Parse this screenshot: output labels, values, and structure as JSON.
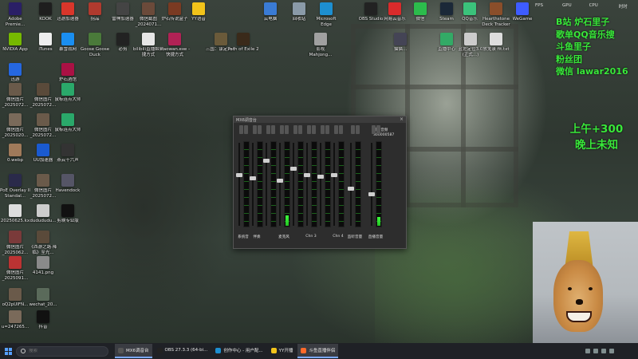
{
  "desktop_icons": [
    {
      "label": "Adobe Premie...",
      "color": "#2a1f66",
      "icon": "premiere-icon"
    },
    {
      "label": "KOOK",
      "color": "#1e1e1e",
      "icon": "kook-icon"
    },
    {
      "label": "迅游加速器",
      "color": "#d9362b",
      "icon": "xunyou-icon"
    },
    {
      "label": "拐品",
      "color": "#b03a2e",
      "icon": "app-icon"
    },
    {
      "label": "雷神加速器",
      "color": "#444",
      "icon": "leishen-icon"
    },
    {
      "label": "微信截图_2024071...",
      "color": "#6b4a3a",
      "icon": "image-icon"
    },
    {
      "label": "炉石传说盒子",
      "color": "#7a3a22",
      "icon": "hearthstone-box-icon"
    },
    {
      "label": "YY语音",
      "color": "#f2c31a",
      "icon": "yy-icon"
    },
    {
      "label": "云电脑",
      "color": "#3a7bd5",
      "icon": "cloud-pc-icon"
    },
    {
      "label": "回收站",
      "color": "#8a9aa8",
      "icon": "recycle-bin-icon"
    },
    {
      "label": "Microsoft Edge",
      "color": "#1d8fd1",
      "icon": "edge-icon"
    },
    {
      "label": "OBS Studio",
      "color": "#222",
      "icon": "obs-icon"
    },
    {
      "label": "网易云音乐",
      "color": "#d92b2b",
      "icon": "netease-icon"
    },
    {
      "label": "微信",
      "color": "#2cbc4c",
      "icon": "wechat-icon"
    },
    {
      "label": "Steam",
      "color": "#1b2838",
      "icon": "steam-icon"
    },
    {
      "label": "QQ音乐",
      "color": "#3bc27b",
      "icon": "qqmusic-icon"
    },
    {
      "label": "Hearthstone Deck Tracker",
      "color": "#8a4e2a",
      "icon": "hdt-icon"
    },
    {
      "label": "WeGame",
      "color": "#3e5cff",
      "icon": "wegame-icon"
    },
    {
      "label": "NVIDIA App",
      "color": "#76b900",
      "icon": "nvidia-icon"
    },
    {
      "label": "iTunes",
      "color": "#eeeeee",
      "icon": "itunes-icon"
    },
    {
      "label": "暴雪战网",
      "color": "#1a8ef0",
      "icon": "battlenet-icon"
    },
    {
      "label": "Goose Goose Duck",
      "color": "#4a7a3a",
      "icon": "goose-icon"
    },
    {
      "label": "必剪",
      "color": "#222",
      "icon": "bijian-icon"
    },
    {
      "label": "bilibili直播姬快捷方式",
      "color": "#e6e6e6",
      "icon": "bilibili-icon"
    },
    {
      "label": "xiaowan.exe - 快捷方式",
      "color": "#b02255",
      "icon": "xiaowan-icon"
    },
    {
      "label": "三国：谋定天下",
      "color": "#6a5a3a",
      "icon": "sanguo-icon"
    },
    {
      "label": "Path of Exile 2",
      "color": "#3a2a1a",
      "icon": "poe2-icon"
    },
    {
      "label": "影视 Mahjong...",
      "color": "#a0a0a0",
      "icon": "mahjong-icon"
    },
    {
      "label": "猫猫...",
      "color": "#445",
      "icon": "app-icon"
    },
    {
      "label": "直播中心",
      "color": "#3a6",
      "icon": "live-center-icon"
    },
    {
      "label": "蓝佐定位3.0 (正式...)",
      "color": "#ccc",
      "icon": "doc-icon"
    },
    {
      "label": "放鬼录 fit.txt",
      "color": "#ddd",
      "icon": "txt-icon"
    },
    {
      "label": "迅游",
      "color": "#2567e0",
      "icon": "xunyou2-icon"
    },
    {
      "label": "炉石酒馆",
      "color": "#a14",
      "icon": "tavern-icon"
    },
    {
      "label": "微信图片_2025072...",
      "color": "#6a5a4a",
      "icon": "image-icon"
    },
    {
      "label": "微信图片_2025072...",
      "color": "#5a4a3a",
      "icon": "image-icon"
    },
    {
      "label": "鼠标连点大师",
      "color": "#2aa86a",
      "icon": "autoclick-icon"
    },
    {
      "label": "微信图片_2025020...",
      "color": "#7a6a5a",
      "icon": "image-icon"
    },
    {
      "label": "微信图片_2025072...",
      "color": "#6a5a4a",
      "icon": "image-icon"
    },
    {
      "label": "鼠标连点大师",
      "color": "#2aa86a",
      "icon": "autoclick-icon"
    },
    {
      "label": "0.webp",
      "color": "#a07a5a",
      "icon": "image-icon"
    },
    {
      "label": "UU加速器",
      "color": "#1a5ad0",
      "icon": "uu-icon"
    },
    {
      "label": "燕云十六声",
      "color": "#333",
      "icon": "yanyun-icon"
    },
    {
      "label": "PoE Overlay II Standal...",
      "color": "#2a2a4a",
      "icon": "poe-overlay-icon"
    },
    {
      "label": "微信图片_2025072...",
      "color": "#6a5a4a",
      "icon": "image-icon"
    },
    {
      "label": "Havendock",
      "color": "#556",
      "icon": "havendock-icon"
    },
    {
      "label": "20250625.kx",
      "color": "#ddd",
      "icon": "doc-icon"
    },
    {
      "label": "dudududu...",
      "color": "#ccc",
      "icon": "doc-icon"
    },
    {
      "label": "剪映专业版",
      "color": "#111",
      "icon": "jianying-icon"
    },
    {
      "label": "微信图片_2025062...",
      "color": "#7a3a3a",
      "icon": "image-icon"
    },
    {
      "label": "《西游之路·降临》至光...",
      "color": "#5a4a3a",
      "icon": "image-icon"
    },
    {
      "label": "微信图片_2025091...",
      "color": "#b33",
      "icon": "image-icon"
    },
    {
      "label": "4141.png",
      "color": "#8a8a8a",
      "icon": "image-icon"
    },
    {
      "label": "oQ2pUIFN...",
      "color": "#6a5a4a",
      "icon": "image-icon"
    },
    {
      "label": "wechat_20...",
      "color": "#5a6a5a",
      "icon": "image-icon"
    },
    {
      "label": "u=247265...",
      "color": "#7a6a5a",
      "icon": "image-icon"
    },
    {
      "label": "抖音",
      "color": "#111",
      "icon": "douyin-icon"
    }
  ],
  "overlay": {
    "lines": [
      "B站 炉石里子",
      "歌单QQ音乐搜",
      "斗鱼里子",
      "粉丝团",
      "微信  lawar2016"
    ],
    "stream_lines": [
      "上午+300",
      "晚上未知"
    ]
  },
  "hud": {
    "fps": "FPS",
    "gpu": "GPU",
    "cpu": "CPU",
    "time": "时时"
  },
  "mixer": {
    "title": "MX6调音台",
    "output_label": "输出音频",
    "output_value": "300000587",
    "channels": [
      {
        "label": "系统音",
        "fader": 0.62,
        "level": 0.0
      },
      {
        "label": "伴奏",
        "fader": 0.58,
        "level": 0.0
      },
      {
        "label": "",
        "fader": 0.8,
        "level": 0.0
      },
      {
        "label": "麦克风",
        "fader": 0.55,
        "level": 0.12
      },
      {
        "label": "",
        "fader": 0.7,
        "level": 0.0
      },
      {
        "label": "Chn 3",
        "fader": 0.62,
        "level": 0.0
      },
      {
        "label": "",
        "fader": 0.6,
        "level": 0.0
      },
      {
        "label": "Chn 4",
        "fader": 0.62,
        "level": 0.0
      },
      {
        "label": "监听音量",
        "fader": 0.45,
        "level": 0.0
      },
      {
        "label": "直播音量",
        "fader": 0.38,
        "level": 0.1
      }
    ]
  },
  "taskbar": {
    "search_placeholder": "搜索",
    "items": [
      {
        "label": "MX6调音台",
        "icon": "mixer-icon",
        "color": "#555",
        "active": true
      },
      {
        "label": "OBS 27.3.3 (64-bi...",
        "icon": "obs-icon",
        "color": "#222",
        "active": false
      },
      {
        "label": "创作中心 - 用户配...",
        "icon": "edge-icon",
        "color": "#1d8fd1",
        "active": false
      },
      {
        "label": "YY开播",
        "icon": "yy-icon",
        "color": "#f2c31a",
        "active": false
      },
      {
        "label": "斗鱼直播伴侣",
        "icon": "douyu-icon",
        "color": "#ff6a2a",
        "active": true
      }
    ]
  }
}
